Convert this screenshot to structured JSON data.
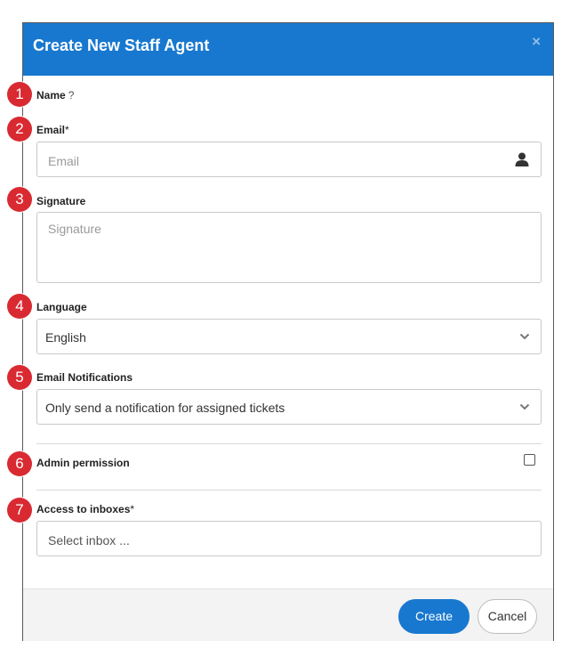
{
  "dialog": {
    "title": "Create New Staff Agent",
    "close_label": "×"
  },
  "form": {
    "name": {
      "label": "Name",
      "help": "?"
    },
    "email": {
      "label": "Email",
      "required_mark": "*",
      "placeholder": "Email",
      "addon_icon": "user-icon"
    },
    "signature": {
      "label": "Signature",
      "placeholder": "Signature"
    },
    "language": {
      "label": "Language",
      "value": "English"
    },
    "notifications": {
      "label": "Email Notifications",
      "value": "Only send a notification for assigned tickets"
    },
    "admin": {
      "label": "Admin permission",
      "checked": false
    },
    "inboxes": {
      "label": "Access to inboxes",
      "required_mark": "*",
      "placeholder": "Select inbox ..."
    }
  },
  "footer": {
    "create_label": "Create",
    "cancel_label": "Cancel"
  },
  "annotations": [
    "1",
    "2",
    "3",
    "4",
    "5",
    "6",
    "7"
  ],
  "colors": {
    "accent": "#1878cf",
    "badge": "#d92a32"
  }
}
